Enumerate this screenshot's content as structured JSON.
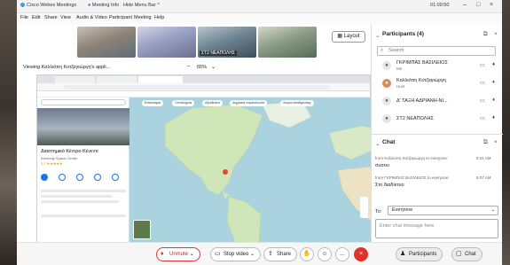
{
  "titlebar": {
    "app": "Cisco Webex Meetings",
    "meeting_info": "Meeting Info",
    "hide_menu": "Hide Menu Bar",
    "timer": "01:00:50"
  },
  "menu": [
    "File",
    "Edit",
    "Share",
    "View",
    "Audio & Video",
    "Participant",
    "Meeting",
    "Help"
  ],
  "videos": [
    {
      "label": ""
    },
    {
      "label": ""
    },
    {
      "label": "ΣΤ2 ΝΕΑΠΟΛΗΣ"
    },
    {
      "label": ""
    }
  ],
  "layout_label": "Layout",
  "viewing": {
    "text": "Viewing Καλλιόπη Κοτζαγιώργη's appli...",
    "zoom": "65%"
  },
  "maps": {
    "place_name": "Διαστημικό Κέντρο Κένεντι",
    "place_sub": "Kennedy Space Center",
    "rating": "4,7 ★★★★★",
    "chips": [
      "Εστιατόρια",
      "Ξενοδοχεία",
      "Αξιοθέατα",
      "Δημόσια συγκοινωνία",
      "Χώροι στάθμευσης"
    ]
  },
  "toolbar": {
    "unmute": "Unmute",
    "stop_video": "Stop video",
    "share": "Share",
    "more": "...",
    "participants": "Participants",
    "chat": "Chat"
  },
  "panel": {
    "participants_title": "Participants (4)",
    "search_placeholder": "Search",
    "participants": [
      {
        "name": "ΓΚΡΙΜΠΑΣ ΒΑΣΙΛΕΙΟΣ",
        "role": "Me",
        "mic_muted": false
      },
      {
        "name": "Καλλιόπη Κοτζαγιώργη",
        "role": "Host",
        "mic_muted": true
      },
      {
        "name": "Δ' ΤΑΞΗ ΑΔΡΙΑΝΗ-ΝΙ...",
        "role": "",
        "mic_muted": true
      },
      {
        "name": "ΣΤ2 ΝΕΑΠΟΛΗΣ",
        "role": "",
        "mic_muted": false
      }
    ],
    "chat_title": "Chat",
    "messages": [
      {
        "meta": "from Καλλιόπη Κοτζαγιώργη to everyone:",
        "time": "9:31 AM",
        "text": "συσου"
      },
      {
        "meta": "from ΓΚΡΙΜΠΑΣ ΒΑΣΙΛΕΙΟΣ to everyone:",
        "time": "9:37 AM",
        "text": "Στο διαδίκτυο"
      }
    ],
    "to_label": "To:",
    "to_value": "Everyone",
    "chat_placeholder": "Enter chat message here"
  }
}
